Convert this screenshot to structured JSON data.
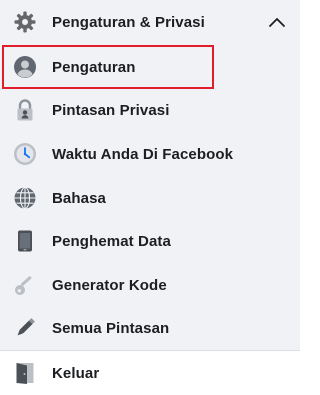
{
  "section": {
    "title": "Pengaturan & Privasi",
    "expanded": true
  },
  "items": [
    {
      "label": "Pengaturan",
      "icon": "profile-icon"
    },
    {
      "label": "Pintasan Privasi",
      "icon": "lock-icon"
    },
    {
      "label": "Waktu Anda Di Facebook",
      "icon": "clock-icon"
    },
    {
      "label": "Bahasa",
      "icon": "globe-icon"
    },
    {
      "label": "Penghemat Data",
      "icon": "phone-icon"
    },
    {
      "label": "Generator Kode",
      "icon": "key-icon"
    },
    {
      "label": "Semua Pintasan",
      "icon": "pencil-icon"
    }
  ],
  "logout": {
    "label": "Keluar",
    "icon": "door-exit-icon"
  },
  "colors": {
    "section_bg": "#f0f2f5",
    "highlight_border": "#e01e2b",
    "text": "#1c1e21"
  }
}
